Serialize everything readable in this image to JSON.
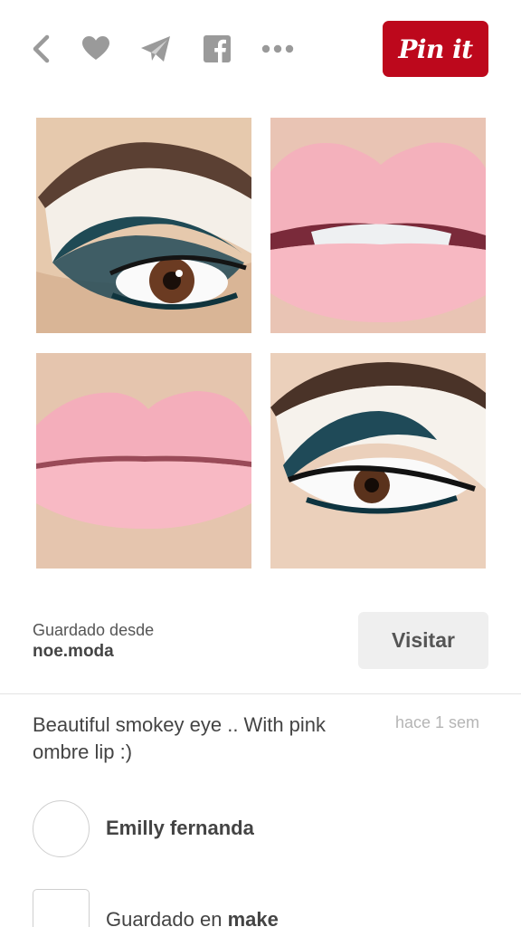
{
  "toolbar": {
    "icons": [
      "back-chevron-icon",
      "heart-icon",
      "send-icon",
      "facebook-icon",
      "more-icon"
    ],
    "pin_button_label": "Pin it",
    "brand_color": "#bd081c",
    "icon_color": "#9a9a9a"
  },
  "pin": {
    "source_label": "Guardado desde",
    "source_domain": "noe.moda",
    "visit_label": "Visitar",
    "description": "Beautiful smokey eye .. With pink ombre lip :)",
    "timestamp": "hace 1 sem"
  },
  "user": {
    "name": "Emilly fernanda"
  },
  "board": {
    "prefix": "Guardado en",
    "name": "make"
  }
}
